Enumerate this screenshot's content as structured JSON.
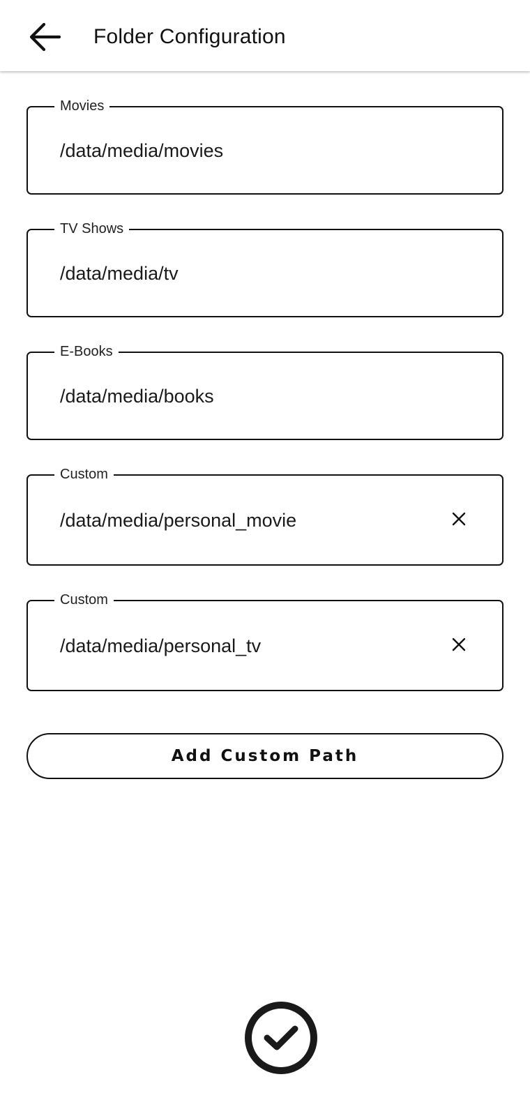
{
  "header": {
    "title": "Folder Configuration",
    "back_icon": "arrow-left-icon"
  },
  "fields": [
    {
      "label": "Movies",
      "value": "/data/media/movies",
      "removable": false
    },
    {
      "label": "TV Shows",
      "value": "/data/media/tv",
      "removable": false
    },
    {
      "label": "E-Books",
      "value": "/data/media/books",
      "removable": false
    },
    {
      "label": "Custom",
      "value": "/data/media/personal_movie",
      "removable": true
    },
    {
      "label": "Custom",
      "value": "/data/media/personal_tv",
      "removable": true
    }
  ],
  "actions": {
    "add_custom_path_label": "Add Custom Path",
    "confirm_icon": "check-circle-icon",
    "clear_icon": "close-icon"
  },
  "colors": {
    "foreground": "#111111",
    "background": "#ffffff"
  }
}
